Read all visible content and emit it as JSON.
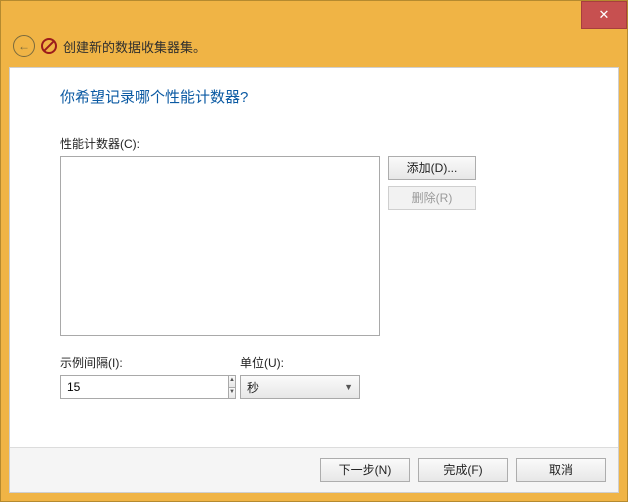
{
  "titlebar": {
    "close_symbol": "✕"
  },
  "header": {
    "back_arrow": "←",
    "title": "创建新的数据收集器集。"
  },
  "main": {
    "heading": "你希望记录哪个性能计数器?",
    "counters_label": "性能计数器(C):",
    "add_button": "添加(D)...",
    "remove_button": "删除(R)",
    "interval_label": "示例间隔(I):",
    "interval_value": "15",
    "unit_label": "单位(U):",
    "unit_value": "秒"
  },
  "footer": {
    "next": "下一步(N)",
    "finish": "完成(F)",
    "cancel": "取消"
  }
}
